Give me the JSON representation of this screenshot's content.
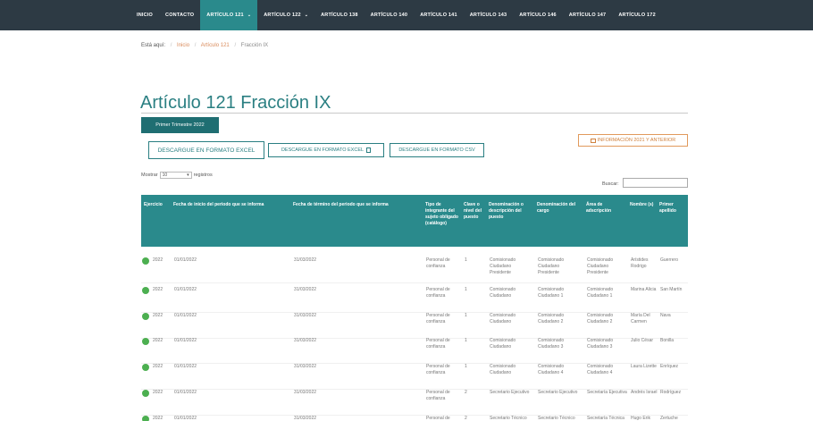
{
  "nav": {
    "items": [
      {
        "label": "INICIO"
      },
      {
        "label": "CONTACTO"
      },
      {
        "label": "ARTÍCULO 121",
        "caret": "⌄"
      },
      {
        "label": "ARTÍCULO 122",
        "caret": "⌄"
      },
      {
        "label": "ARTÍCULO 138"
      },
      {
        "label": "ARTÍCULO 140"
      },
      {
        "label": "ARTÍCULO 141"
      },
      {
        "label": "ARTÍCULO 143"
      },
      {
        "label": "ARTÍCULO 146"
      },
      {
        "label": "ARTÍCULO 147"
      },
      {
        "label": "ARTÍCULO 172"
      }
    ]
  },
  "breadcrumb": {
    "lead": "Está aquí:",
    "home": "Inicio",
    "section": "Artículo 121",
    "current": "Fracción IX",
    "separator": "/"
  },
  "page_title": "Artículo 121 Fracción IX",
  "period_button": "Primer Trimestre 2022",
  "downloads": {
    "excel": "DESCARGUE EN FORMATO EXCEL",
    "excel_alt": "DESCARGUE EN FORMATO EXCEL",
    "csv": "DESCARGUE EN FORMATO CSV"
  },
  "info_button": "INFORMACIÓN 2021 Y ANTERIOR",
  "show": {
    "prefix": "Mostrar",
    "value": "10",
    "suffix": "registros"
  },
  "search_label": "Buscar:",
  "accent_colors": {
    "nav_bg": "#2d3a44",
    "teal": "#2a8a8c",
    "orange": "#e19a5c",
    "status_dot": "#4caf50"
  },
  "table": {
    "headers": [
      "Ejercicio",
      "Fecha de inicio del periodo que se informa",
      "Fecha de término del periodo que se informa",
      "Tipo de integrante del sujeto obligado (catálogo)",
      "Clave o nivel del puesto",
      "Denominación o descripción del puesto",
      "Denominación del cargo",
      "Área de adscripción",
      "Nombre (s)",
      "Primer apellido"
    ],
    "rows": [
      [
        "2022",
        "01/01/2022",
        "31/03/2022",
        "Personal de confianza",
        "1",
        "Comisionado Ciudadano Presidente",
        "Comisionado Ciudadano Presidente",
        "Comisionado Ciudadano Presidente",
        "Arístides Rodrigo",
        "Guerrero"
      ],
      [
        "2022",
        "01/01/2022",
        "31/03/2022",
        "Personal de confianza",
        "1",
        "Comisionado Ciudadano",
        "Comisionado Ciudadano 1",
        "Comisionado Ciudadano 1",
        "Marina Alicia",
        "San Martín"
      ],
      [
        "2022",
        "01/01/2022",
        "31/03/2022",
        "Personal de confianza",
        "1",
        "Comisionado Ciudadano",
        "Comisionado Ciudadano 2",
        "Comisionado Ciudadano 2",
        "María Del Carmen",
        "Nava"
      ],
      [
        "2022",
        "01/01/2022",
        "31/03/2022",
        "Personal de confianza",
        "1",
        "Comisionado Ciudadano",
        "Comisionado Ciudadano 3",
        "Comisionado Ciudadano 3",
        "Julio César",
        "Bonilla"
      ],
      [
        "2022",
        "01/01/2022",
        "31/03/2022",
        "Personal de confianza",
        "1",
        "Comisionado Ciudadano",
        "Comisionado Ciudadano 4",
        "Comisionado Ciudadano 4",
        "Laura Lizette",
        "Enríquez"
      ],
      [
        "2022",
        "01/01/2022",
        "31/03/2022",
        "Personal de confianza",
        "2",
        "Secretario Ejecutivo",
        "Secretario Ejecutivo",
        "Secretaría Ejecutiva",
        "Andrés Israel",
        "Rodríguez"
      ],
      [
        "2022",
        "01/01/2022",
        "31/03/2022",
        "Personal de confianza",
        "2",
        "Secretario Técnico",
        "Secretario Técnico",
        "Secretaría Técnica",
        "Hugo Erik",
        "Zertuche"
      ]
    ]
  }
}
